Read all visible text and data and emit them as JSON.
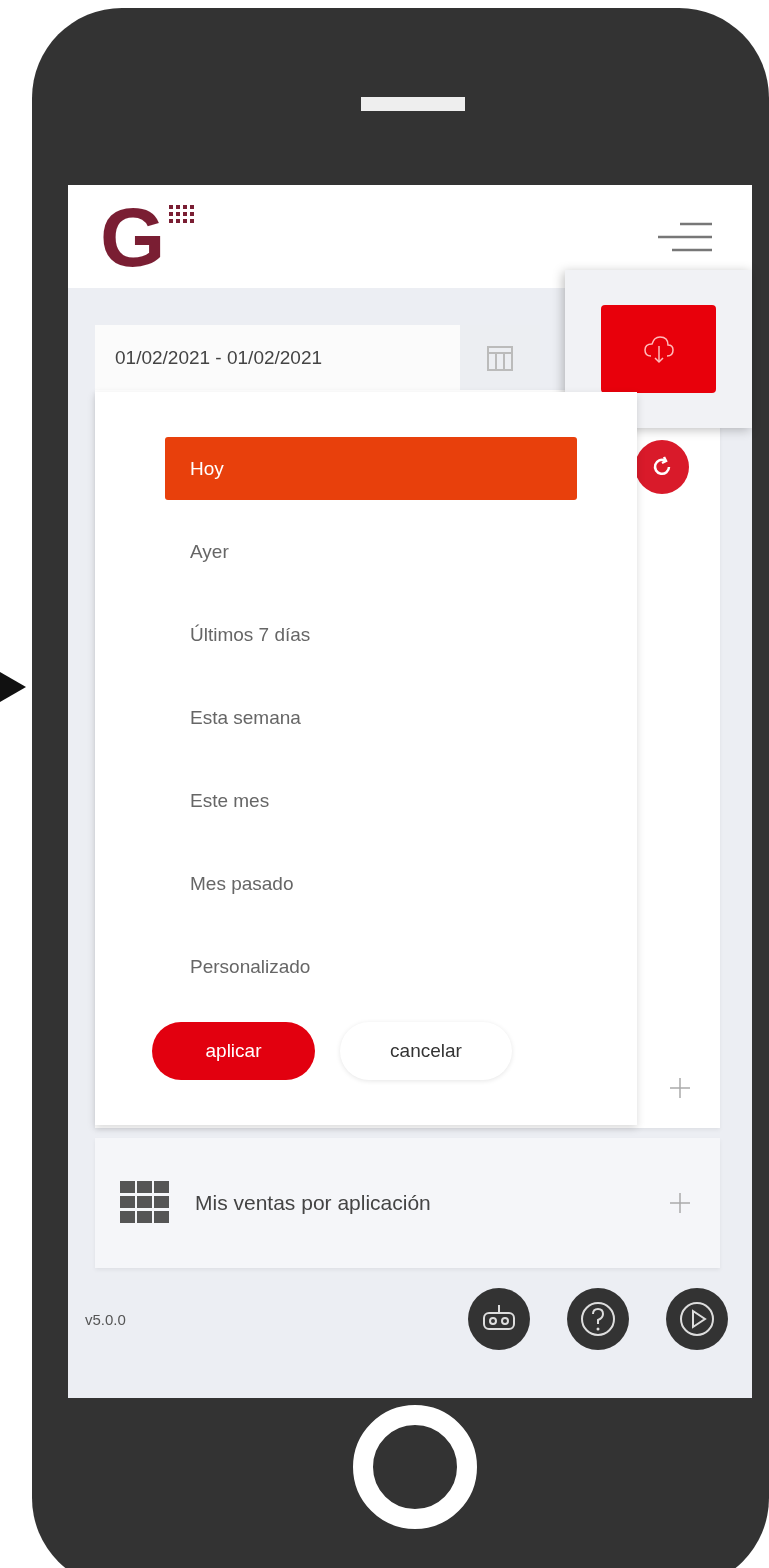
{
  "header": {
    "logo_letter": "G"
  },
  "date_range": {
    "value": "01/02/2021 - 01/02/2021"
  },
  "range_options": [
    {
      "label": "Hoy",
      "selected": true
    },
    {
      "label": "Ayer",
      "selected": false
    },
    {
      "label": "Últimos 7 días",
      "selected": false
    },
    {
      "label": "Esta semana",
      "selected": false
    },
    {
      "label": "Este mes",
      "selected": false
    },
    {
      "label": "Mes pasado",
      "selected": false
    },
    {
      "label": "Personalizado",
      "selected": false
    }
  ],
  "actions": [
    {
      "label": "aplicar",
      "kind": "primary"
    },
    {
      "label": "cancelar",
      "kind": "secondary"
    }
  ],
  "sections": [
    {
      "title": "Mis ventas por aplicación"
    }
  ],
  "footer": {
    "version": "v5.0.0"
  }
}
